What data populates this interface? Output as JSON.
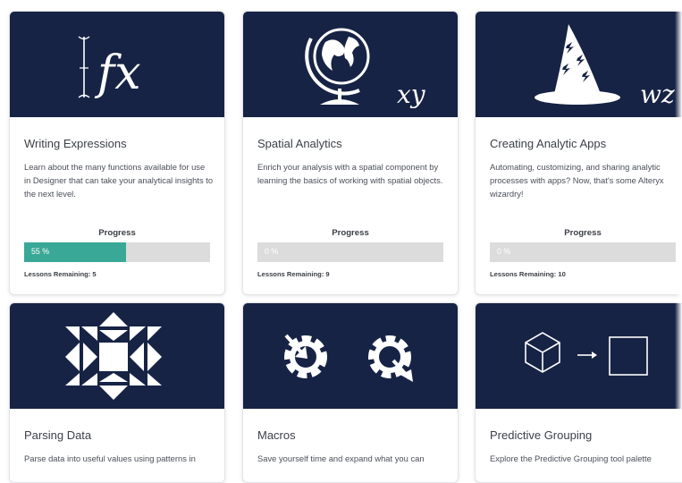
{
  "cards": [
    {
      "title": "Writing Expressions",
      "description": "Learn about the many functions available for use in Designer that can take your analytical insights to the next level.",
      "progress_label": "Progress",
      "progress_value": 0.55,
      "progress_text": "55 %",
      "lessons_remaining": "Lessons Remaining: 5",
      "banner_text": "fx",
      "icon": "function-fx-icon"
    },
    {
      "title": "Spatial Analytics",
      "description": "Enrich your analysis with a spatial component by learning the basics of working with spatial objects.",
      "progress_label": "Progress",
      "progress_value": 0,
      "progress_text": "0 %",
      "lessons_remaining": "Lessons Remaining: 9",
      "banner_text": "xy",
      "icon": "globe-icon"
    },
    {
      "title": "Creating Analytic Apps",
      "description": "Automating, customizing, and sharing analytic processes with apps? Now, that's some Alteryx wizardry!",
      "progress_label": "Progress",
      "progress_value": 0,
      "progress_text": "0 %",
      "lessons_remaining": "Lessons Remaining: 10",
      "banner_text": "wz",
      "icon": "wizard-hat-icon"
    },
    {
      "title": "Parsing Data",
      "description": "Parse data into useful values using patterns in",
      "icon": "quilt-pattern-icon"
    },
    {
      "title": "Macros",
      "description": "Save yourself time and expand what you can",
      "icon": "gears-icon"
    },
    {
      "title": "Predictive Grouping",
      "description": "Explore the Predictive Grouping tool palette",
      "icon": "cube-to-square-icon"
    }
  ],
  "colors": {
    "banner": "#172345",
    "progress_fill": "#3aa896",
    "progress_track": "#dcdcdc"
  }
}
